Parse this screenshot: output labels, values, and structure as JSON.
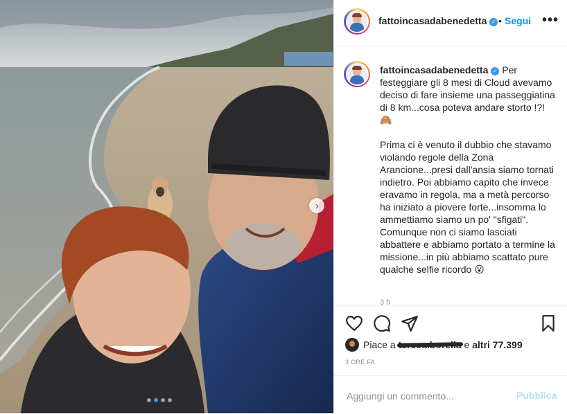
{
  "post": {
    "username": "fattoincasadabenedetta",
    "follow_label": "Segui",
    "separator": "•",
    "more_icon": "more-horizontal-icon",
    "caption_paragraphs": [
      "Per festeggiare gli 8 mesi di Cloud avevamo deciso di fare insieme una passeggiatina di 8 km...cosa poteva andare storto !?! 🙈",
      "Prima ci è venuto il dubbio che stavamo violando regole della Zona Arancione...presi dall'ansia siamo tornati indietro. Poi abbiamo capito che invece eravamo in regola, ma a metà percorso ha iniziato a piovere forte...insomma lo ammettiamo siamo un po' \"sfigati\". Comunque non ci siamo lasciati abbattere e abbiamo portato a termine la missione...in più abbiamo scattato pure qualche selfie ricordo 😮"
    ],
    "caption_time": "3 h",
    "likes": {
      "prefix": "Piace a",
      "liker": "teresa.borella",
      "middle": "e",
      "others": "altri 77.399"
    },
    "posted_time": "3 ORE FA",
    "comment_placeholder": "Aggiungi un commento...",
    "publish_label": "Pubblica",
    "carousel": {
      "count": 4,
      "active": 1
    }
  },
  "colors": {
    "accent": "#0095f6",
    "publish_disabled": "#b2dffc",
    "verified": "#3897f0"
  }
}
